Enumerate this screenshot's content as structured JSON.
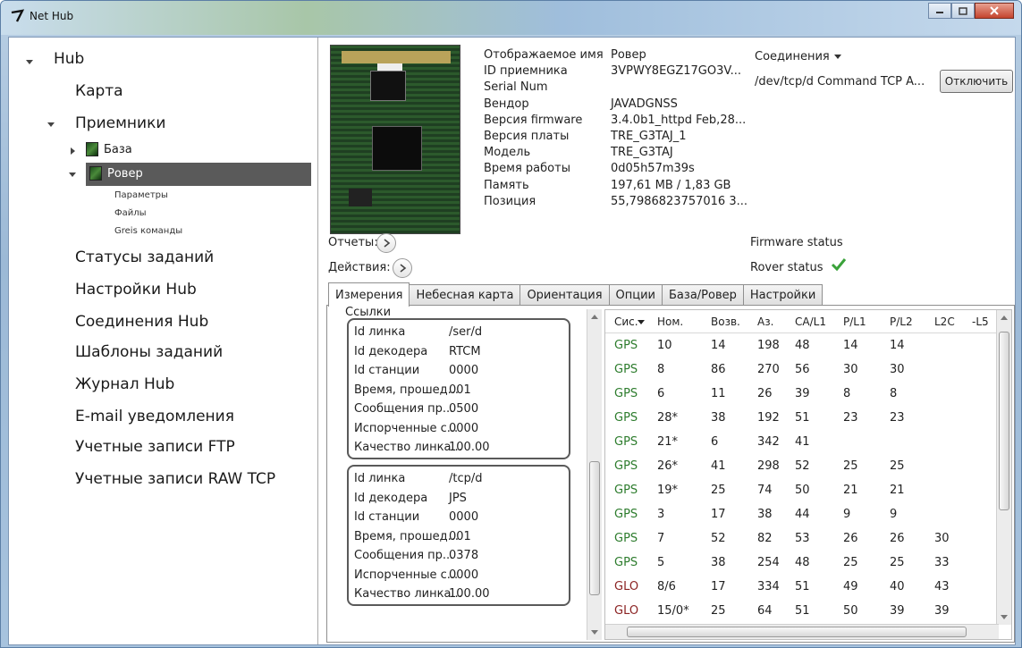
{
  "window": {
    "title": "Net Hub"
  },
  "nav": {
    "root": "Hub",
    "map": "Карта",
    "receivers": "Приемники",
    "base": "База",
    "rover": "Ровер",
    "rover_children": [
      "Параметры",
      "Файлы",
      "Greis команды"
    ],
    "items": [
      "Статусы заданий",
      "Настройки Hub",
      "Соединения Hub",
      "Шаблоны заданий",
      "Журнал Hub",
      "E-mail уведомления",
      "Учетные записи FTP",
      "Учетные записи RAW TCP"
    ]
  },
  "info": {
    "rows": [
      {
        "label": "Отображаемое имя",
        "value": "Ровер"
      },
      {
        "label": "ID приемника",
        "value": "3VPWY8EGZ17GO3V..."
      },
      {
        "label": "Serial Num",
        "value": ""
      },
      {
        "label": "Вендор",
        "value": "JAVADGNSS"
      },
      {
        "label": "Версия firmware",
        "value": "3.4.0b1_httpd Feb,28..."
      },
      {
        "label": "Версия платы",
        "value": "TRE_G3TAJ_1"
      },
      {
        "label": "Модель",
        "value": "TRE_G3TAJ"
      },
      {
        "label": "Время работы",
        "value": "0d05h57m39s"
      },
      {
        "label": "Память",
        "value": "197,61 MB / 1,83 GB"
      },
      {
        "label": "Позиция",
        "value": "55,7986823757016 3..."
      }
    ]
  },
  "connections": {
    "header": "Соединения",
    "path": "/dev/tcp/d Command TCP A...",
    "disconnect": "Отключить"
  },
  "reports_label": "Отчеты:",
  "actions_label": "Действия:",
  "firmware_status": "Firmware status",
  "rover_status": "Rover status",
  "tabs": [
    "Измерения",
    "Небесная карта",
    "Ориентация",
    "Опции",
    "База/Ровер",
    "Настройки"
  ],
  "links": {
    "caption": "Ссылки",
    "boxes": [
      {
        "rows": [
          {
            "label": "Id линка",
            "value": "/ser/d"
          },
          {
            "label": "Id декодера",
            "value": "RTCM"
          },
          {
            "label": "Id станции",
            "value": "0000"
          },
          {
            "label": "Время, прошед...",
            "value": "001"
          },
          {
            "label": "Сообщения пр...",
            "value": "0500"
          },
          {
            "label": "Испорченные с...",
            "value": "0000"
          },
          {
            "label": "Качество линка...",
            "value": "100.00"
          }
        ]
      },
      {
        "rows": [
          {
            "label": "Id линка",
            "value": "/tcp/d"
          },
          {
            "label": "Id декодера",
            "value": "JPS"
          },
          {
            "label": "Id станции",
            "value": "0000"
          },
          {
            "label": "Время, прошед...",
            "value": "001"
          },
          {
            "label": "Сообщения пр...",
            "value": "0378"
          },
          {
            "label": "Испорченные с...",
            "value": "0000"
          },
          {
            "label": "Качество линка...",
            "value": "100.00"
          }
        ]
      }
    ]
  },
  "satellites": {
    "headers": [
      "Сис.",
      "Ном.",
      "Возв.",
      "Аз.",
      "CA/L1",
      "P/L1",
      "P/L2",
      "L2C",
      "-L5"
    ],
    "rows": [
      [
        "GPS",
        "10",
        "14",
        "198",
        "48",
        "14",
        "14",
        ""
      ],
      [
        "GPS",
        "8",
        "86",
        "270",
        "56",
        "30",
        "30",
        ""
      ],
      [
        "GPS",
        "6",
        "11",
        "26",
        "39",
        "8",
        "8",
        ""
      ],
      [
        "GPS",
        "28*",
        "38",
        "192",
        "51",
        "23",
        "23",
        ""
      ],
      [
        "GPS",
        "21*",
        "6",
        "342",
        "41",
        "",
        "",
        ""
      ],
      [
        "GPS",
        "26*",
        "41",
        "298",
        "52",
        "25",
        "25",
        ""
      ],
      [
        "GPS",
        "19*",
        "25",
        "74",
        "50",
        "21",
        "21",
        ""
      ],
      [
        "GPS",
        "3",
        "17",
        "38",
        "44",
        "9",
        "9",
        ""
      ],
      [
        "GPS",
        "7",
        "52",
        "82",
        "53",
        "26",
        "26",
        "30"
      ],
      [
        "GPS",
        "5",
        "38",
        "254",
        "48",
        "25",
        "25",
        "33"
      ],
      [
        "GLO",
        "8/6",
        "17",
        "334",
        "51",
        "49",
        "40",
        "43"
      ],
      [
        "GLO",
        "15/0*",
        "25",
        "64",
        "51",
        "50",
        "39",
        "39"
      ]
    ]
  }
}
